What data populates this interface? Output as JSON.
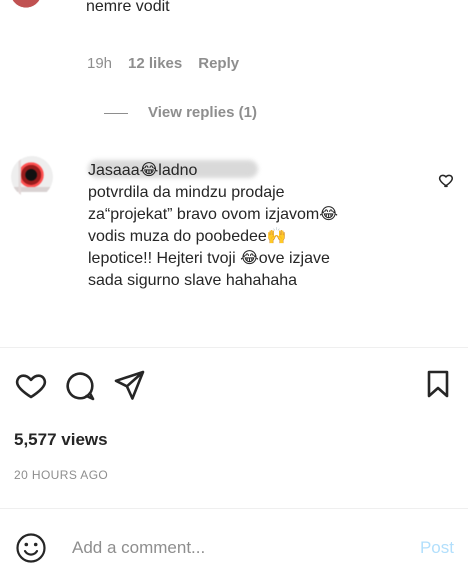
{
  "top_comment": {
    "partial_text": "nemre vodit",
    "time": "19h",
    "likes": "12 likes",
    "reply_label": "Reply",
    "view_replies_label": "View replies (1)"
  },
  "comment": {
    "text": "Jasaaa😂ladno\npotvrdila da mindzu prodaje\nza“projekat” bravo ovom izjavom😂\nvodis muza do poobedee🙌\nlepotice!! Hejteri tvoji 😂ove izjave\nsada sigurno slave hahahaha"
  },
  "post_actions": {
    "like_icon": "heart-outline",
    "comment_icon": "speech-bubble",
    "share_icon": "paper-plane",
    "save_icon": "bookmark"
  },
  "stats": {
    "views": "5,577 views",
    "time_ago": "20 HOURS AGO"
  },
  "comment_box": {
    "placeholder": "Add a comment...",
    "post_label": "Post",
    "emoji_icon": "smiley-face"
  },
  "colors": {
    "text": "#262626",
    "secondary_text": "#8e8e8e",
    "divider": "#efefef",
    "post_disabled": "#b2dffc"
  }
}
